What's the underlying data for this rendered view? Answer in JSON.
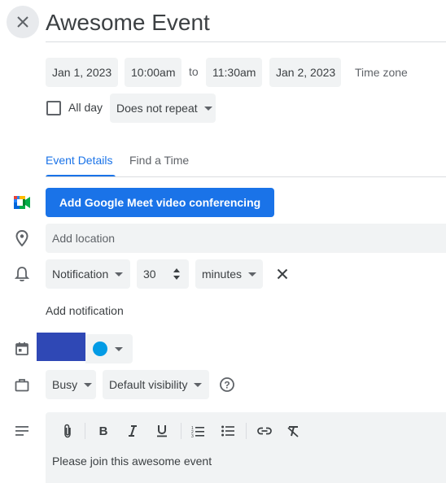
{
  "header": {
    "title": "Awesome Event",
    "close_icon": "close-icon"
  },
  "datetime": {
    "start_date": "Jan 1, 2023",
    "start_time": "10:00am",
    "to": "to",
    "end_time": "11:30am",
    "end_date": "Jan 2, 2023",
    "time_zone": "Time zone"
  },
  "options": {
    "all_day_label": "All day",
    "all_day_checked": false,
    "repeat": "Does not repeat"
  },
  "tabs": [
    {
      "label": "Event Details",
      "active": true
    },
    {
      "label": "Find a Time",
      "active": false
    }
  ],
  "meet": {
    "button_label": "Add Google Meet video conferencing",
    "icon": "google-meet-icon"
  },
  "location": {
    "placeholder": "Add location",
    "icon": "location-pin-icon"
  },
  "notification": {
    "type": "Notification",
    "value": "30",
    "unit": "minutes",
    "add_label": "Add notification",
    "icon": "bell-icon"
  },
  "calendar": {
    "icon": "calendar-icon",
    "color_swatch": "#2f48b5",
    "event_color": "#039be5"
  },
  "availability": {
    "status": "Busy",
    "visibility": "Default visibility",
    "icon": "briefcase-icon",
    "help_icon": "help-circle-icon"
  },
  "description": {
    "icon": "notes-icon",
    "text": "Please join this awesome event",
    "toolbar": [
      "attachment-icon",
      "bold-icon",
      "italic-icon",
      "underline-icon",
      "numbered-list-icon",
      "bulleted-list-icon",
      "link-icon",
      "clear-formatting-icon"
    ]
  },
  "colors": {
    "accent": "#1a73e8",
    "chip_bg": "#f1f3f4",
    "text": "#3c4043",
    "icon": "#5f6368"
  }
}
